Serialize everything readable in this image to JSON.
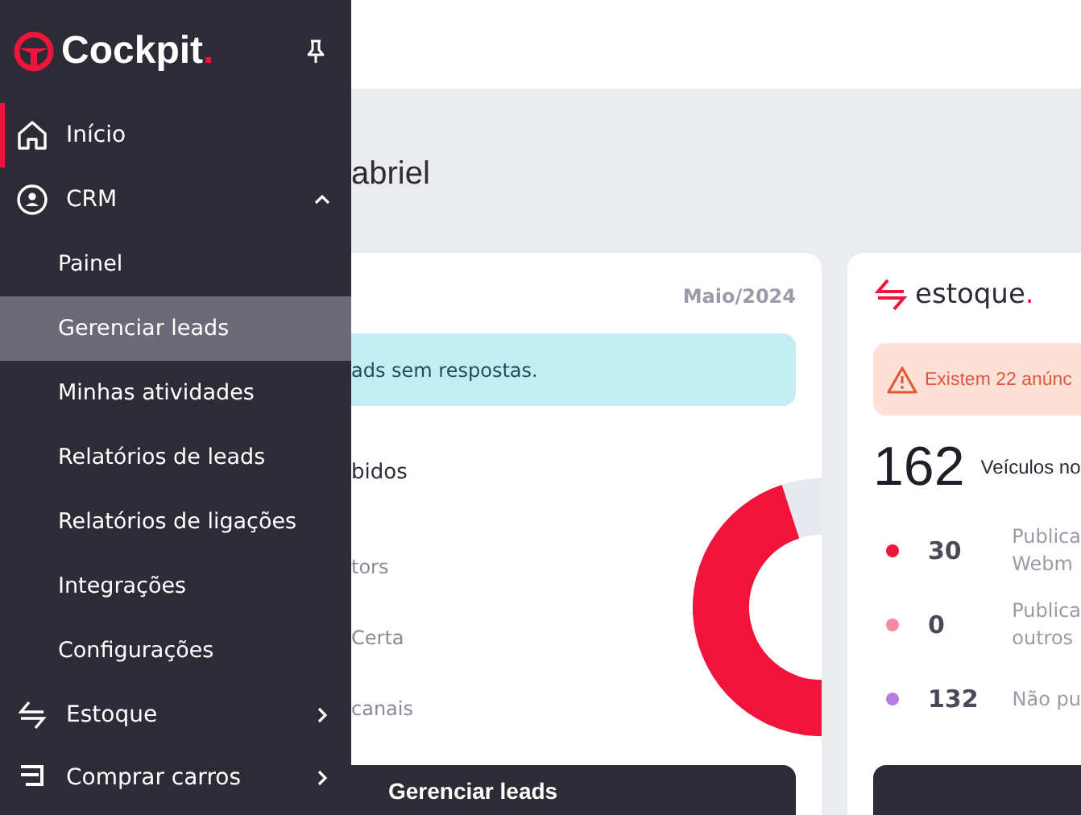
{
  "sidebar": {
    "logo": {
      "text": "Cockpit",
      "dot": "."
    },
    "items": [
      {
        "label": "Início",
        "selected": true
      },
      {
        "label": "CRM",
        "selected": false,
        "expanded": true,
        "children": [
          {
            "label": "Painel",
            "selected": false
          },
          {
            "label": "Gerenciar leads",
            "selected": true
          },
          {
            "label": "Minhas atividades",
            "selected": false
          },
          {
            "label": "Relatórios de leads",
            "selected": false
          },
          {
            "label": "Relatórios de ligações",
            "selected": false
          },
          {
            "label": "Integrações",
            "selected": false
          },
          {
            "label": "Configurações",
            "selected": false
          }
        ]
      },
      {
        "label": "Estoque",
        "selected": false,
        "expanded": false
      },
      {
        "label": "Comprar carros",
        "selected": false,
        "expanded": false
      }
    ]
  },
  "main": {
    "greeting": "abriel",
    "leads_card": {
      "period": "Maio/2024",
      "alert": "ads sem respostas.",
      "rows": [
        {
          "label": "bidos",
          "kind": "total"
        },
        {
          "label": "tors",
          "kind": "source"
        },
        {
          "label": "Certa",
          "kind": "source"
        },
        {
          "label": "canais",
          "kind": "source"
        }
      ],
      "button": "Gerenciar leads"
    },
    "stock_card": {
      "logo": {
        "text": "estoque",
        "dot": "."
      },
      "alert": "Existem 22 anúnc",
      "total": "162",
      "total_label": "Veículos no",
      "items": [
        {
          "color": "#f0143c",
          "count": "30",
          "lines": [
            "Publica",
            "Webm"
          ]
        },
        {
          "color": "#f58ba0",
          "count": "0",
          "lines": [
            "Publica",
            "outros"
          ]
        },
        {
          "color": "#b57be0",
          "count": "132",
          "lines": [
            "Não pu"
          ]
        }
      ]
    }
  }
}
